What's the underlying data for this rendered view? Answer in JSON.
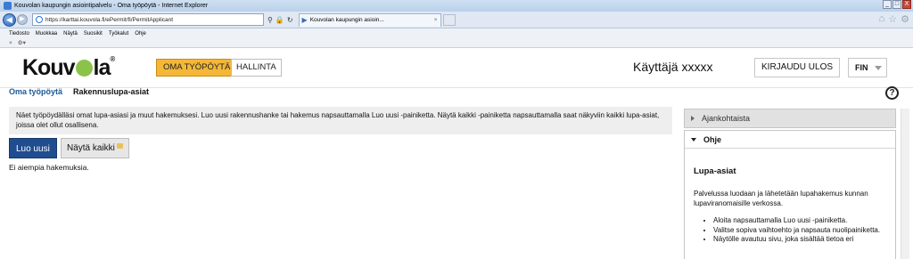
{
  "browser": {
    "window_title": "Kouvolan kaupungin asiointipalvelu - Oma työpöytä - Internet Explorer",
    "address": "https://karttai.kouvola.fi/ePermit/fi/PermitApplicant",
    "tab_title": "Kouvolan kaupungin asioin...",
    "menu": [
      "Tiedosto",
      "Muokkaa",
      "Näytä",
      "Suosikit",
      "Työkalut",
      "Ohje"
    ],
    "winbtns": [
      "_",
      "□",
      "X"
    ]
  },
  "header": {
    "logo_part1": "Kouv",
    "logo_part2": "la",
    "nav_primary": "OMA TYÖPÖYTÄ",
    "nav_secondary": "HALLINTA",
    "user": "Käyttäjä xxxxx",
    "logout": "KIRJAUDU ULOS",
    "language": "FIN"
  },
  "breadcrumb": {
    "active": "Oma työpöytä",
    "current": "Rakennuslupa-asiat"
  },
  "help_label": "?",
  "main": {
    "info_text": "Näet työpöydälläsi omat lupa-asiasi ja muut hakemuksesi. Luo uusi rakennushanke tai hakemus napsauttamalla Luo uusi -painiketta. Näytä kaikki -painiketta napsauttamalla saat näkyviin kaikki lupa-asiat, joissa olet ollut osallisena.",
    "new_button": "Luo uusi",
    "show_all_button": "Näytä kaikki",
    "empty_text": "Ei aiempia hakemuksia."
  },
  "sidebar": {
    "news_title": "Ajankohtaista",
    "help_title": "Ohje",
    "help_heading": "Lupa-asiat",
    "help_paragraph": "Palvelussa luodaan ja lähetetään lupahakemus kunnan lupaviranomaisille verkossa.",
    "help_list": [
      "Aloita napsauttamalla Luo uusi -painiketta.",
      "Valitse sopiva vaihtoehto ja napsauta nuolipainiketta.",
      "Näytölle avautuu sivu, joka sisältää tietoa eri"
    ]
  }
}
